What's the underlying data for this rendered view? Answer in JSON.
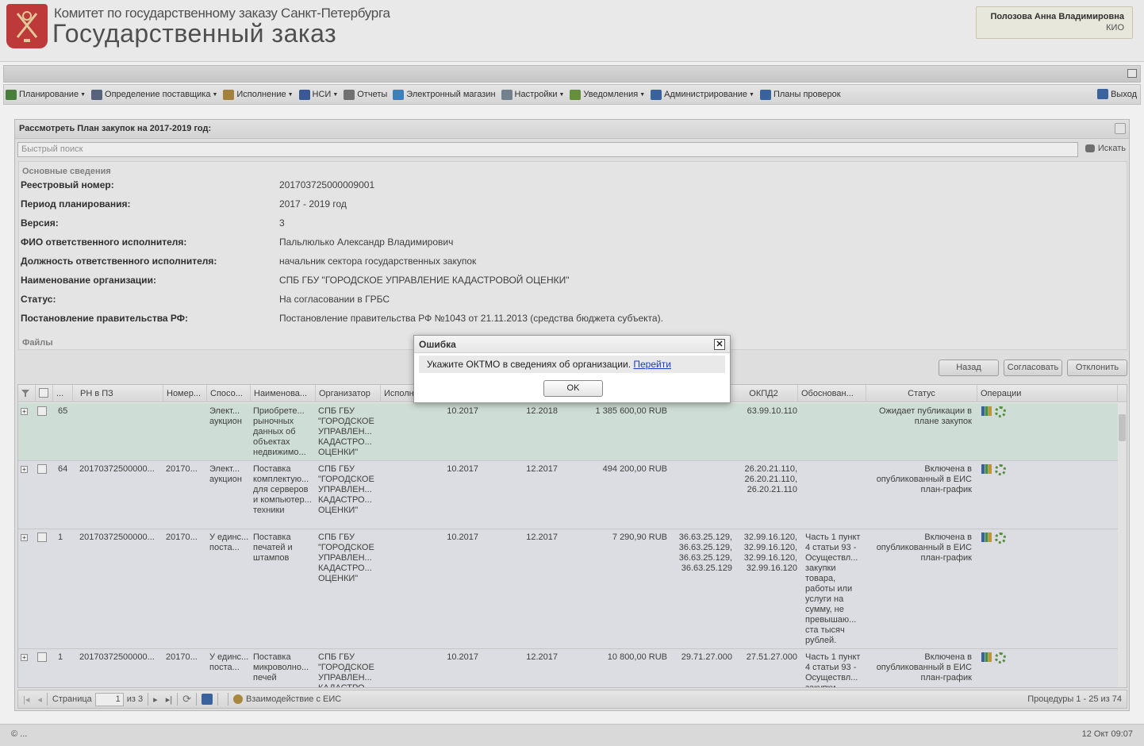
{
  "header": {
    "org_top": "Комитет по государственному заказу Санкт-Петербурга",
    "org_main": "Государственный заказ",
    "user_name": "Полозова Анна Владимировна",
    "user_role": "КИО"
  },
  "menu": {
    "items": [
      {
        "label": "Планирование",
        "dropdown": true,
        "icon": "planning-icon",
        "color": "#4a8a3a"
      },
      {
        "label": "Определение поставщика",
        "dropdown": true,
        "icon": "gears-icon",
        "color": "#5c6b8a"
      },
      {
        "label": "Исполнение",
        "dropdown": true,
        "icon": "execution-icon",
        "color": "#b58a3a"
      },
      {
        "label": "НСИ",
        "dropdown": true,
        "icon": "book-icon",
        "color": "#3a5fa8"
      },
      {
        "label": "Отчеты",
        "dropdown": false,
        "icon": "report-icon",
        "color": "#7a7a7a"
      },
      {
        "label": "Электронный магазин",
        "dropdown": false,
        "icon": "cart-icon",
        "color": "#3a8ad0"
      },
      {
        "label": "Настройки",
        "dropdown": true,
        "icon": "wrench-icon",
        "color": "#7a8a9a"
      },
      {
        "label": "Уведомления",
        "dropdown": true,
        "icon": "notification-icon",
        "color": "#6a9a3a"
      },
      {
        "label": "Администрирование",
        "dropdown": true,
        "icon": "admin-user-icon",
        "color": "#3a6ab0"
      },
      {
        "label": "Планы проверок",
        "dropdown": false,
        "icon": "checks-user-icon",
        "color": "#3a6ab0"
      }
    ],
    "exit_label": "Выход"
  },
  "panel": {
    "title": "Рассмотреть План закупок на 2017-2019 год:",
    "search_placeholder": "Быстрый поиск",
    "search_button": "Искать",
    "section_main": "Основные сведения",
    "section_files": "Файлы",
    "fields": [
      {
        "label": "Реестровый номер:",
        "value": "201703725000009001"
      },
      {
        "label": "Период планирования:",
        "value": "2017 - 2019 год"
      },
      {
        "label": "Версия:",
        "value": "3"
      },
      {
        "label": "ФИО ответственного исполнителя:",
        "value": "Пальлюлько Александр Владимирович"
      },
      {
        "label": "Должность ответственного исполнителя:",
        "value": "начальник сектора государственных закупок"
      },
      {
        "label": "Наименование организации:",
        "value": "СПБ ГБУ \"ГОРОДСКОЕ УПРАВЛЕНИЕ КАДАСТРОВОЙ ОЦЕНКИ\""
      },
      {
        "label": "Статус:",
        "value": "На согласовании в ГРБС"
      },
      {
        "label": "Постановление правительства РФ:",
        "value": "Постановление правительства РФ №1043 от 21.11.2013 (средства бюджета субъекта)."
      }
    ],
    "buttons": {
      "back": "Назад",
      "approve": "Согласовать",
      "reject": "Отклонить"
    }
  },
  "grid": {
    "columns": [
      "...",
      "РН в ПЗ",
      "Номер...",
      "Спосо...",
      "Наименова...",
      "Организатор",
      "Исполн",
      "ОКПД2",
      "Обоснован...",
      "Статус",
      "Операции"
    ],
    "rows": [
      {
        "num": "65",
        "rn": "",
        "nomer": "",
        "method": "Элект... аукцион",
        "name": "Приобрете... рыночных данных об объектах недвижимо...",
        "org": "СПБ ГБУ \"ГОРОДСКОЕ УПРАВЛЕН... КАДАСТРО... ОЦЕНКИ\"",
        "start": "10.2017",
        "end": "12.2018",
        "sum": "1 385 600,00 RUB",
        "okpd": "",
        "okpd2": "63.99.10.110",
        "reason": "",
        "status": "Ожидает публикации в плане закупок"
      },
      {
        "num": "64",
        "rn": "20170372500000...",
        "nomer": "20170...",
        "method": "Элект... аукцион",
        "name": "Поставка комплектую... для серверов и компьютер... техники",
        "org": "СПБ ГБУ \"ГОРОДСКОЕ УПРАВЛЕН... КАДАСТРО... ОЦЕНКИ\"",
        "start": "10.2017",
        "end": "12.2017",
        "sum": "494 200,00 RUB",
        "okpd": "",
        "okpd2": "26.20.21.110, 26.20.21.110, 26.20.21.110",
        "reason": "",
        "status": "Включена в опубликованный в ЕИС план-график"
      },
      {
        "num": "1",
        "rn": "20170372500000...",
        "nomer": "20170...",
        "method": "У единс... поста...",
        "name": "Поставка печатей и штампов",
        "org": "СПБ ГБУ \"ГОРОДСКОЕ УПРАВЛЕН... КАДАСТРО... ОЦЕНКИ\"",
        "start": "10.2017",
        "end": "12.2017",
        "sum": "7 290,90 RUB",
        "okpd": "36.63.25.129, 36.63.25.129, 36.63.25.129, 36.63.25.129",
        "okpd2": "32.99.16.120, 32.99.16.120, 32.99.16.120, 32.99.16.120",
        "reason": "Часть 1 пункт 4 статьи 93 - Осуществл... закупки товара, работы или услуги на сумму, не превышаю... ста тысяч рублей.",
        "status": "Включена в опубликованный в ЕИС план-график"
      },
      {
        "num": "1",
        "rn": "20170372500000...",
        "nomer": "20170...",
        "method": "У единс... поста...",
        "name": "Поставка микроволно... печей",
        "org": "СПБ ГБУ \"ГОРОДСКОЕ УПРАВЛЕН... КАДАСТРО...",
        "start": "10.2017",
        "end": "12.2017",
        "sum": "10 800,00 RUB",
        "okpd": "29.71.27.000",
        "okpd2": "27.51.27.000",
        "reason": "Часть 1 пункт 4 статьи 93 - Осуществл... закупки",
        "status": "Включена в опубликованный в ЕИС план-график"
      }
    ]
  },
  "pager": {
    "page_label": "Страница",
    "page_value": "1",
    "of_label": "из 3",
    "eis_label": "Взаимодействие с ЕИС",
    "summary": "Процедуры 1 - 25 из 74"
  },
  "footer": {
    "left": "© ...",
    "right": "12 Окт 09:07"
  },
  "modal": {
    "title": "Ошибка",
    "message": "Укажите ОКТМО в сведениях об организации.",
    "link": "Перейти",
    "ok": "OK"
  }
}
